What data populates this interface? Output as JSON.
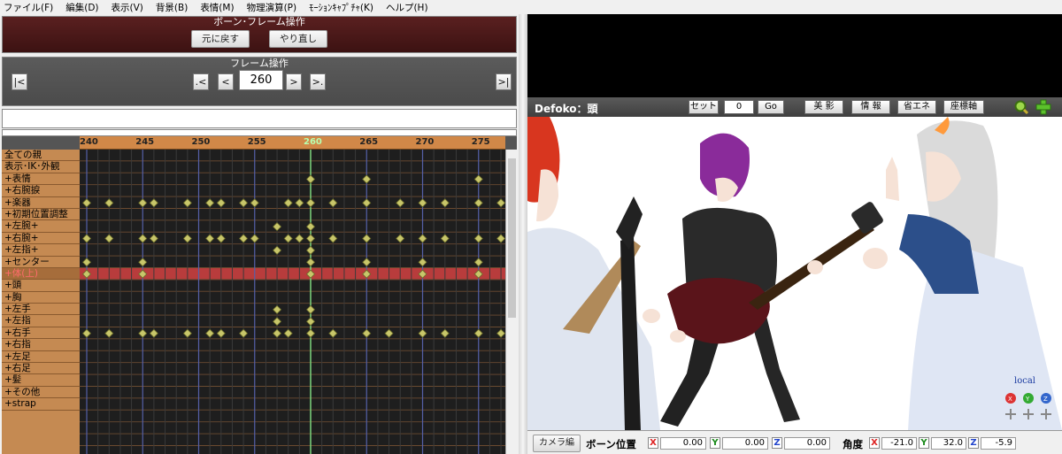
{
  "menu": [
    "ファイル(F)",
    "編集(D)",
    "表示(V)",
    "背景(B)",
    "表情(M)",
    "物理演算(P)",
    "ﾓｰｼｮﾝｷｬﾌﾟﾁｬ(K)",
    "ヘルプ(H)"
  ],
  "bone_panel": {
    "title": "ボーン･フレーム操作",
    "undo_label": "元に戻す",
    "redo_label": "やり直し"
  },
  "frame_panel": {
    "title": "フレーム操作",
    "first_label": "|<",
    "prev_key_label": ".<",
    "prev_label": "<",
    "frame_value": "260",
    "next_label": ">",
    "next_key_label": ">.",
    "last_label": ">|"
  },
  "timeline": {
    "ticks": [
      "240",
      "245",
      "250",
      "255",
      "260",
      "265",
      "270",
      "275"
    ],
    "current_frame": "260",
    "bones": [
      "全ての親",
      "表示･IK･外観",
      "+表情",
      "+右腕捩",
      "+楽器",
      "+初期位置調整",
      "+左腕+",
      "+右腕+",
      "+左指+",
      "+センター",
      "+体(上)",
      "+頭",
      "+胸",
      "+左手",
      "+左指",
      "+右手",
      "+右指",
      "+左足",
      "+右足",
      "+髪",
      "+その他",
      "+strap"
    ],
    "selected_bone": "+体(上)",
    "keyframes": [
      [],
      [],
      [
        260,
        265,
        275
      ],
      [],
      [
        240,
        242,
        245,
        246,
        249,
        251,
        252,
        254,
        255,
        258,
        259,
        260,
        262,
        265,
        268,
        270,
        272,
        275,
        277
      ],
      [],
      [
        257,
        260
      ],
      [
        240,
        242,
        245,
        246,
        249,
        251,
        252,
        254,
        255,
        258,
        259,
        260,
        262,
        265,
        268,
        270,
        272,
        275,
        277
      ],
      [
        257,
        260
      ],
      [
        240,
        245,
        260,
        265,
        270,
        275
      ],
      [
        240,
        245,
        260,
        265,
        270,
        275
      ],
      [],
      [],
      [
        257,
        260
      ],
      [
        257,
        260
      ],
      [
        240,
        242,
        245,
        246,
        249,
        251,
        252,
        254,
        257,
        258,
        260,
        262,
        265,
        267,
        270,
        272,
        275,
        277
      ],
      [],
      [],
      [],
      [],
      [],
      []
    ]
  },
  "viewport": {
    "model_label": "Defoko：頭",
    "set_label": "セット",
    "set_value": "0",
    "go_label": "Go",
    "shadow_label": "美 影",
    "info_label": "情 報",
    "eco_label": "省エネ",
    "axis_label": "座標軸",
    "local_label": "local",
    "camera_mode_label": "カメラ編",
    "bone_pos_label": "ボーン位置",
    "angle_label": "角度",
    "pos": {
      "x": "0.00",
      "y": "0.00",
      "z": "0.00"
    },
    "rot": {
      "x": "-21.0",
      "y": "32.0",
      "z": "-5.9"
    },
    "axes": {
      "x": "X",
      "y": "Y",
      "z": "Z"
    }
  },
  "colors": {
    "panel": "#4a1818",
    "timeline_header": "#d18848",
    "keyframe": "#c8c66a",
    "current_line": "#7dd67d",
    "selected_row": "#b83c3c"
  }
}
